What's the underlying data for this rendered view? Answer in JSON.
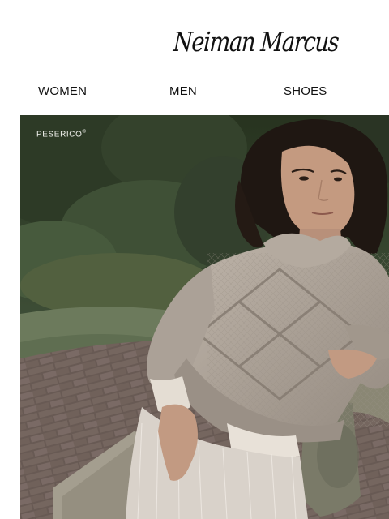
{
  "header": {
    "logo_text": "Neiman Marcus"
  },
  "nav": {
    "items": [
      "WOMEN",
      "MEN",
      "SHOES"
    ]
  },
  "hero": {
    "brand_label": "PESERICO",
    "registered_mark": "®"
  },
  "colors": {
    "foliage_dark": "#2f3b2a",
    "sweater": "#a9a095",
    "skirt": "#d9d2ca",
    "path_brick": "#6e5f58"
  }
}
